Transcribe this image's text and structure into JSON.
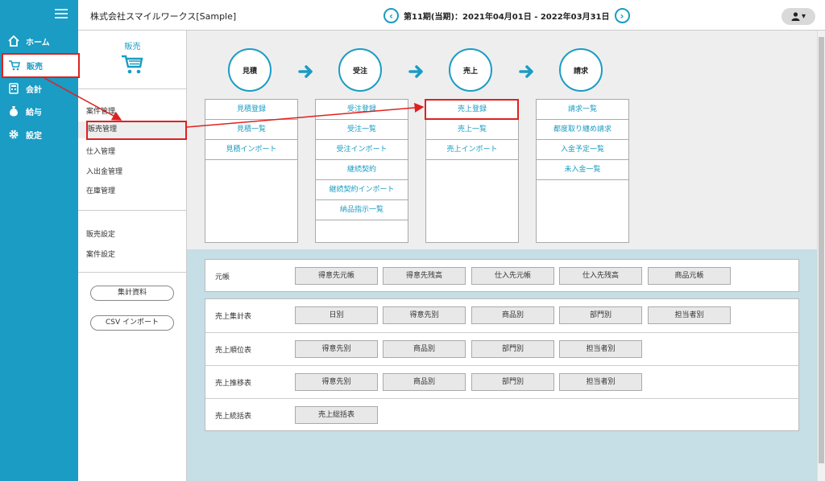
{
  "nav": {
    "items": [
      {
        "label": "ホーム",
        "icon": "home-icon"
      },
      {
        "label": "販売",
        "icon": "cart-icon"
      },
      {
        "label": "会計",
        "icon": "calculator-icon"
      },
      {
        "label": "給与",
        "icon": "moneybag-icon"
      },
      {
        "label": "設定",
        "icon": "gear-icon"
      }
    ]
  },
  "header": {
    "company": "株式会社スマイルワークス[Sample]",
    "period": "第11期(当期)：2021年04月01日 - 2022年03月31日",
    "prev_glyph": "‹",
    "next_glyph": "›",
    "user_glyph": "▾"
  },
  "submenu": {
    "title": "販売",
    "items": [
      "案件管理",
      "販売管理",
      "仕入管理",
      "入出金管理",
      "在庫管理"
    ],
    "settings": [
      "販売設定",
      "案件設定"
    ],
    "buttons": [
      "集計資料",
      "CSV インポート"
    ]
  },
  "flow": {
    "stages": [
      {
        "name": "見積",
        "links": [
          "見積登録",
          "見積一覧",
          "見積インポート"
        ]
      },
      {
        "name": "受注",
        "links": [
          "受注登録",
          "受注一覧",
          "受注インポート",
          "継続契約",
          "継続契約インポート",
          "納品指示一覧"
        ]
      },
      {
        "name": "売上",
        "links": [
          "売上登録",
          "売上一覧",
          "売上インポート"
        ]
      },
      {
        "name": "請求",
        "links": [
          "請求一覧",
          "都度取り纏め請求",
          "入金予定一覧",
          "未入金一覧"
        ]
      }
    ]
  },
  "reports": {
    "ledger": {
      "label": "元帳",
      "buttons": [
        "得意先元帳",
        "得意先残高",
        "仕入先元帳",
        "仕入先残高",
        "商品元帳"
      ]
    },
    "rows": [
      {
        "label": "売上集計表",
        "buttons": [
          "日別",
          "得意先別",
          "商品別",
          "部門別",
          "担当者別"
        ]
      },
      {
        "label": "売上順位表",
        "buttons": [
          "得意先別",
          "商品別",
          "部門別",
          "担当者別"
        ]
      },
      {
        "label": "売上推移表",
        "buttons": [
          "得意先別",
          "商品別",
          "部門別",
          "担当者別"
        ]
      },
      {
        "label": "売上統括表",
        "buttons": [
          "売上総括表"
        ]
      }
    ]
  },
  "colors": {
    "accent": "#1a9cc4",
    "highlight": "#e02020"
  }
}
